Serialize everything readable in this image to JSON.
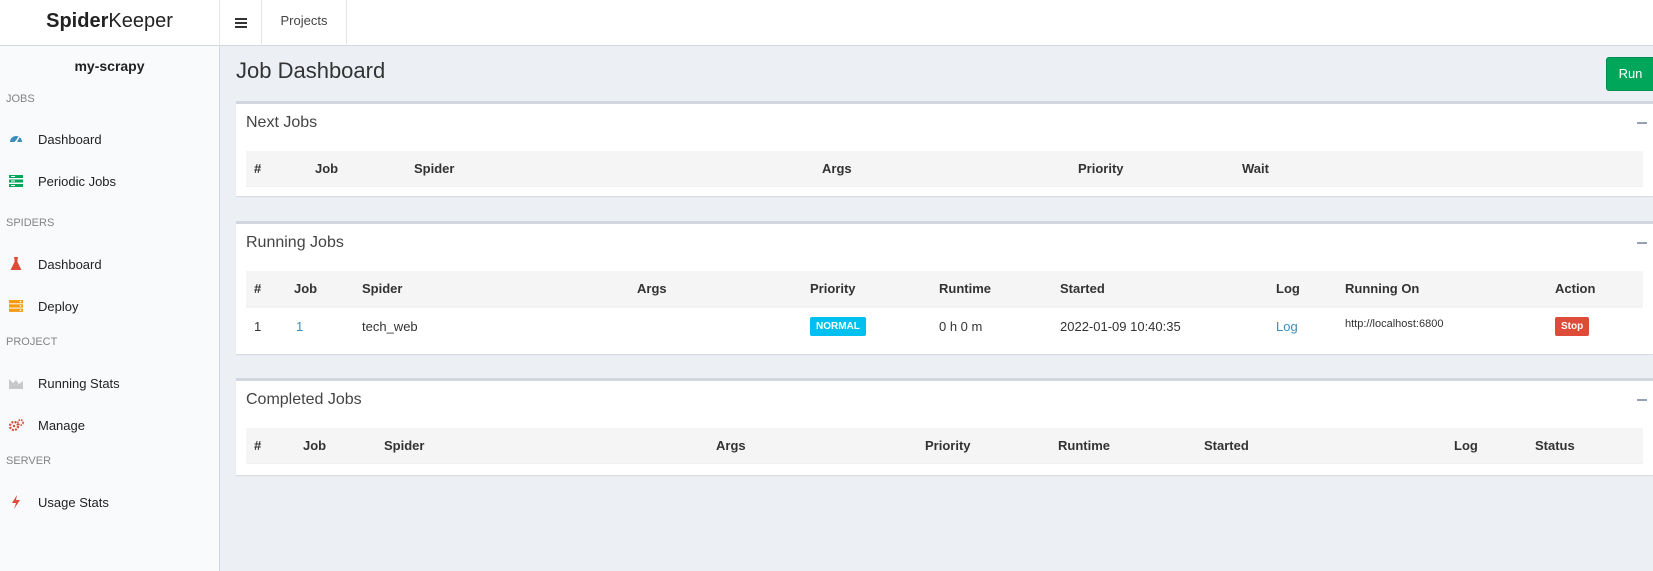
{
  "header": {
    "logo_bold": "Spider",
    "logo_light": "Keeper",
    "projects_label": "Projects"
  },
  "sidebar": {
    "project_name": "my-scrapy",
    "sections": {
      "jobs": "JOBS",
      "spiders": "SPIDERS",
      "project": "PROJECT",
      "server": "SERVER"
    },
    "items": {
      "jobs_dashboard": "Dashboard",
      "periodic_jobs": "Periodic Jobs",
      "spiders_dashboard": "Dashboard",
      "deploy": "Deploy",
      "running_stats": "Running Stats",
      "manage": "Manage",
      "usage_stats": "Usage Stats"
    }
  },
  "main": {
    "title": "Job Dashboard",
    "run_label": "Run",
    "next_jobs": {
      "title": "Next Jobs",
      "columns": [
        "#",
        "Job",
        "Spider",
        "Args",
        "Priority",
        "Wait"
      ]
    },
    "running_jobs": {
      "title": "Running Jobs",
      "columns": [
        "#",
        "Job",
        "Spider",
        "Args",
        "Priority",
        "Runtime",
        "Started",
        "Log",
        "Running On",
        "Action"
      ],
      "rows": [
        {
          "num": "1",
          "job": "1",
          "spider": "tech_web",
          "args": "",
          "priority": "NORMAL",
          "runtime": "0 h 0 m",
          "started": "2022-01-09 10:40:35",
          "log": "Log",
          "running_on": "http://localhost:6800",
          "action": "Stop"
        }
      ]
    },
    "completed_jobs": {
      "title": "Completed Jobs",
      "columns": [
        "#",
        "Job",
        "Spider",
        "Args",
        "Priority",
        "Runtime",
        "Started",
        "Log",
        "Status"
      ]
    }
  },
  "colors": {
    "run_button": "#00a65a",
    "normal_badge": "#00c0ef",
    "stop_button": "#dd4b39",
    "link": "#3c8dbc"
  }
}
